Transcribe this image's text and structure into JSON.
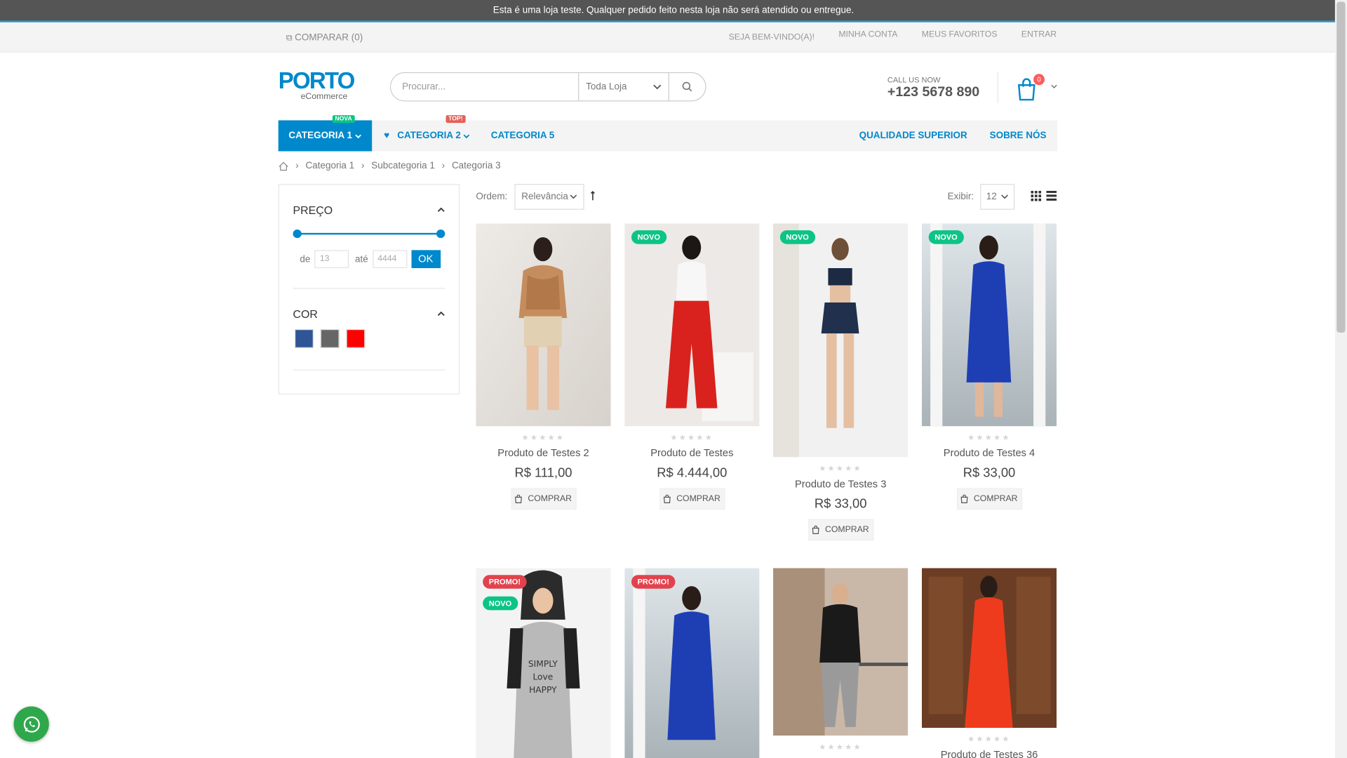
{
  "notice": "Esta é uma loja teste. Qualquer pedido feito nesta loja não será atendido ou entregue.",
  "topbar": {
    "compare": "COMPARAR (0)",
    "welcome": "SEJA BEM-VINDO(A)!",
    "account": "MINHA CONTA",
    "favorites": "MEUS FAVORITOS",
    "login": "ENTRAR"
  },
  "header": {
    "logo_main": "PORTO",
    "logo_sub": "eCommerce",
    "search_placeholder": "Procurar...",
    "search_scope": "Toda Loja",
    "call_label": "CALL US NOW",
    "phone": "+123 5678 890",
    "cart_count": "0"
  },
  "nav": {
    "cat1": "CATEGORIA 1",
    "cat1_tag": "NOVA",
    "cat2": "CATEGORIA 2",
    "cat2_tag": "TOP!",
    "cat5": "CATEGORIA 5",
    "quality": "QUALIDADE SUPERIOR",
    "about": "SOBRE NÓS"
  },
  "breadcrumb": [
    "Categoria 1",
    "Subcategoria 1",
    "Categoria 3"
  ],
  "filters": {
    "price_title": "PREÇO",
    "from_label": "de",
    "from_value": "13",
    "to_label": "até",
    "to_value": "4444",
    "ok": "OK",
    "color_title": "COR",
    "colors": [
      "#2f5597",
      "#666666",
      "#ff0000"
    ]
  },
  "toolbar": {
    "sort_label": "Ordem:",
    "sort_value": "Relevância",
    "show_label": "Exibir:",
    "show_value": "12"
  },
  "products": [
    {
      "name": "Produto de Testes 2",
      "price": "R$ 111,00",
      "buy": "COMPRAR",
      "labels": []
    },
    {
      "name": "Produto de Testes",
      "price": "R$ 4.444,00",
      "buy": "COMPRAR",
      "labels": [
        "NOVO"
      ]
    },
    {
      "name": "Produto de Testes 3",
      "price": "R$ 33,00",
      "buy": "COMPRAR",
      "labels": [
        "NOVO"
      ]
    },
    {
      "name": "Produto de Testes 4",
      "price": "R$ 33,00",
      "buy": "COMPRAR",
      "labels": [
        "NOVO"
      ]
    },
    {
      "labels": [
        "PROMO!",
        "NOVO"
      ]
    },
    {
      "labels": [
        "PROMO!"
      ]
    },
    {
      "labels": []
    },
    {
      "name": "Produto de Testes 36",
      "labels": []
    }
  ],
  "colors": {
    "accent": "#0088cc",
    "new_label": "#0cc485",
    "promo_label": "#e2424d",
    "nova_tag": "#0cc485",
    "top_tag": "#e36159",
    "whatsapp": "#2ea84a"
  }
}
